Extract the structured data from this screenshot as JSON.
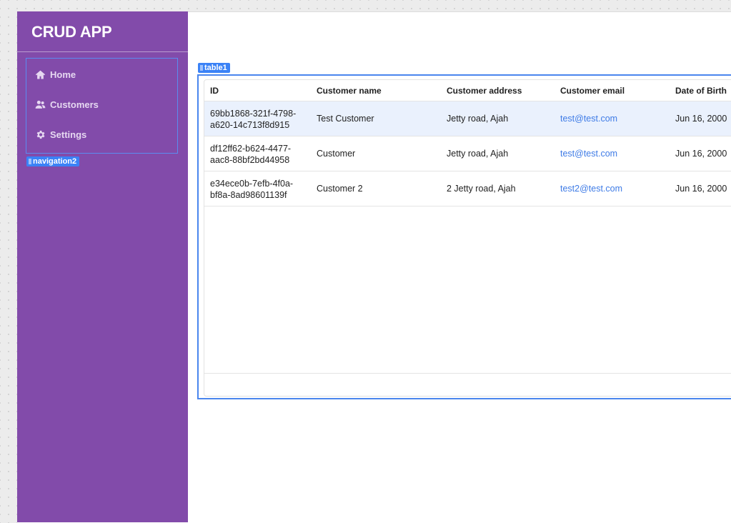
{
  "app": {
    "title": "CRUD APP"
  },
  "navigation": {
    "tag": "navigation2",
    "items": [
      {
        "label": "Home",
        "icon": "home-icon"
      },
      {
        "label": "Customers",
        "icon": "users-icon"
      },
      {
        "label": "Settings",
        "icon": "gear-icon"
      }
    ]
  },
  "table": {
    "tag": "table1",
    "columns": [
      "ID",
      "Customer name",
      "Customer address",
      "Customer email",
      "Date of Birth"
    ],
    "rows": [
      {
        "id": "69bb1868-321f-4798-a620-14c713f8d915",
        "name": "Test Customer",
        "address": "Jetty road, Ajah",
        "email": "test@test.com",
        "dob": "Jun 16, 2000"
      },
      {
        "id": "df12ff62-b624-4477-aac8-88bf2bd44958",
        "name": "Customer",
        "address": "Jetty road, Ajah",
        "email": "test@test.com",
        "dob": "Jun 16, 2000"
      },
      {
        "id": "e34ece0b-7efb-4f0a-bf8a-8ad98601139f",
        "name": "Customer 2",
        "address": "2 Jetty road, Ajah",
        "email": "test2@test.com",
        "dob": "Jun 16, 2000"
      }
    ]
  },
  "colors": {
    "sidebar": "#824baa",
    "selection": "#4a86ee",
    "link": "#3e7be6",
    "selected_row": "#eaf1fd"
  }
}
